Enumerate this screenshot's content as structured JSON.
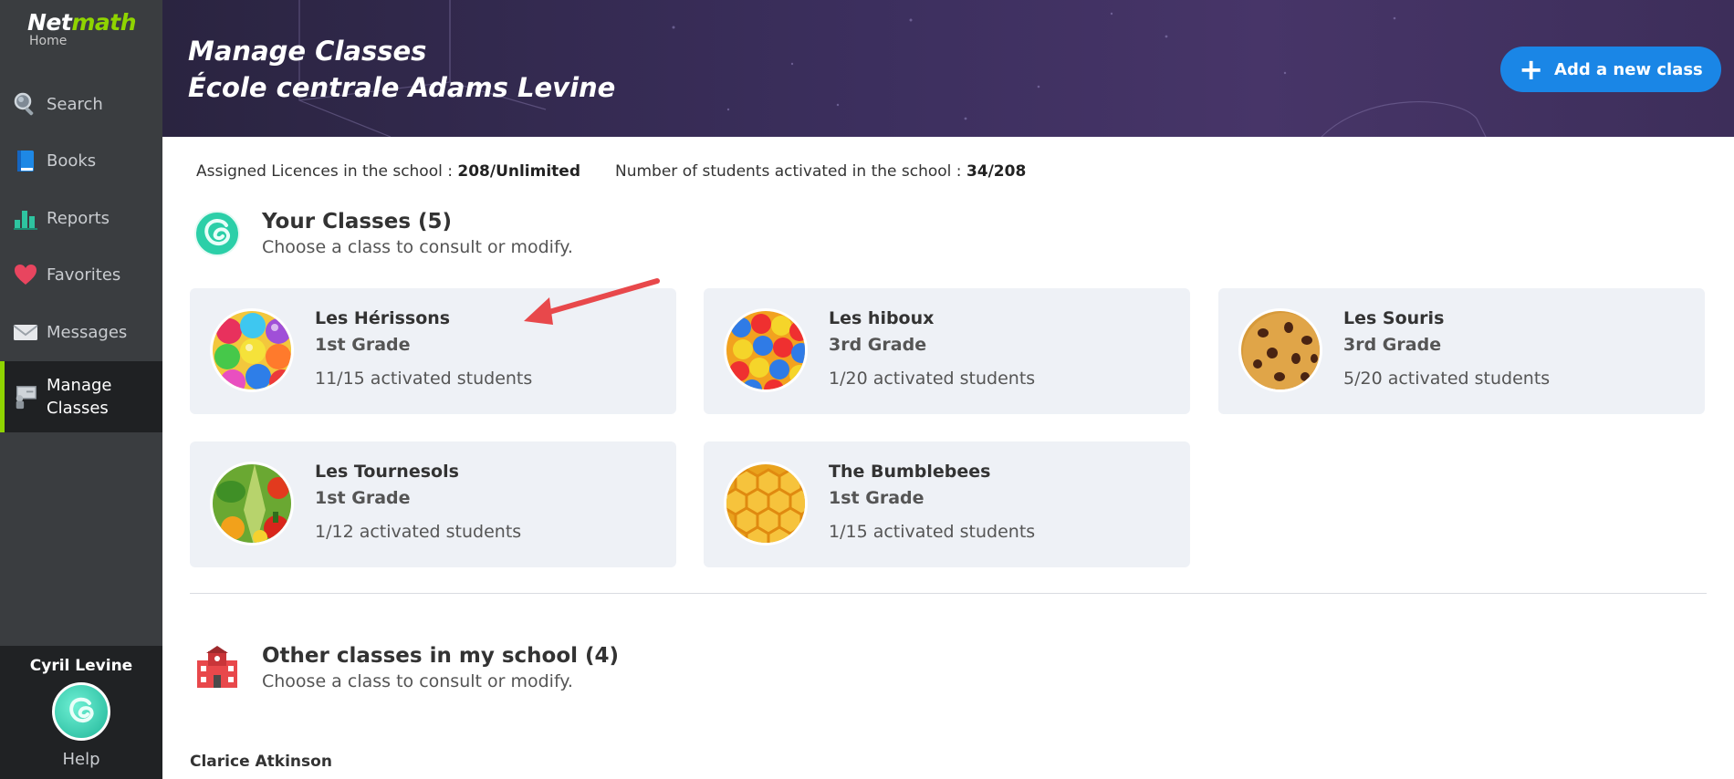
{
  "app": {
    "logo_main": "Net",
    "logo_accent": "math",
    "logo_sub": "Home"
  },
  "sidebar": {
    "items": [
      {
        "label": "Search",
        "icon": "search-icon"
      },
      {
        "label": "Books",
        "icon": "book-icon"
      },
      {
        "label": "Reports",
        "icon": "bar-chart-icon"
      },
      {
        "label": "Favorites",
        "icon": "heart-icon"
      },
      {
        "label": "Messages",
        "icon": "envelope-icon"
      },
      {
        "label": "Manage Classes",
        "icon": "classroom-icon",
        "active": true
      }
    ],
    "user_name": "Cyril Levine",
    "help": "Help"
  },
  "banner": {
    "title_line1": "Manage Classes",
    "title_line2": "École centrale Adams Levine",
    "add_button": "Add a new class"
  },
  "stats": {
    "licences_label": "Assigned Licences in the school :",
    "licences_value": "208/Unlimited",
    "activated_label": "Number of students activated in the school :",
    "activated_value": "34/208"
  },
  "your_classes": {
    "title": "Your Classes (5)",
    "subtitle": "Choose a class to consult or modify.",
    "classes": [
      {
        "name": "Les Hérissons",
        "grade": "1st Grade",
        "students": "11/15 activated students",
        "image": "candy-balls"
      },
      {
        "name": "Les hiboux",
        "grade": "3rd Grade",
        "students": "1/20 activated students",
        "image": "gumballs"
      },
      {
        "name": "Les Souris",
        "grade": "3rd Grade",
        "students": "5/20 activated students",
        "image": "cookie"
      },
      {
        "name": "Les Tournesols",
        "grade": "1st Grade",
        "students": "1/12 activated students",
        "image": "vegetables"
      },
      {
        "name": "The Bumblebees",
        "grade": "1st Grade",
        "students": "1/15 activated students",
        "image": "honeycomb"
      }
    ]
  },
  "other_classes": {
    "title": "Other classes in my school (4)",
    "subtitle": "Choose a class to consult or modify.",
    "first_teacher": "Clarice Atkinson"
  },
  "colors": {
    "accent_green": "#8fd400",
    "button_blue": "#1a86e6",
    "annotation_red": "#e8484b"
  }
}
